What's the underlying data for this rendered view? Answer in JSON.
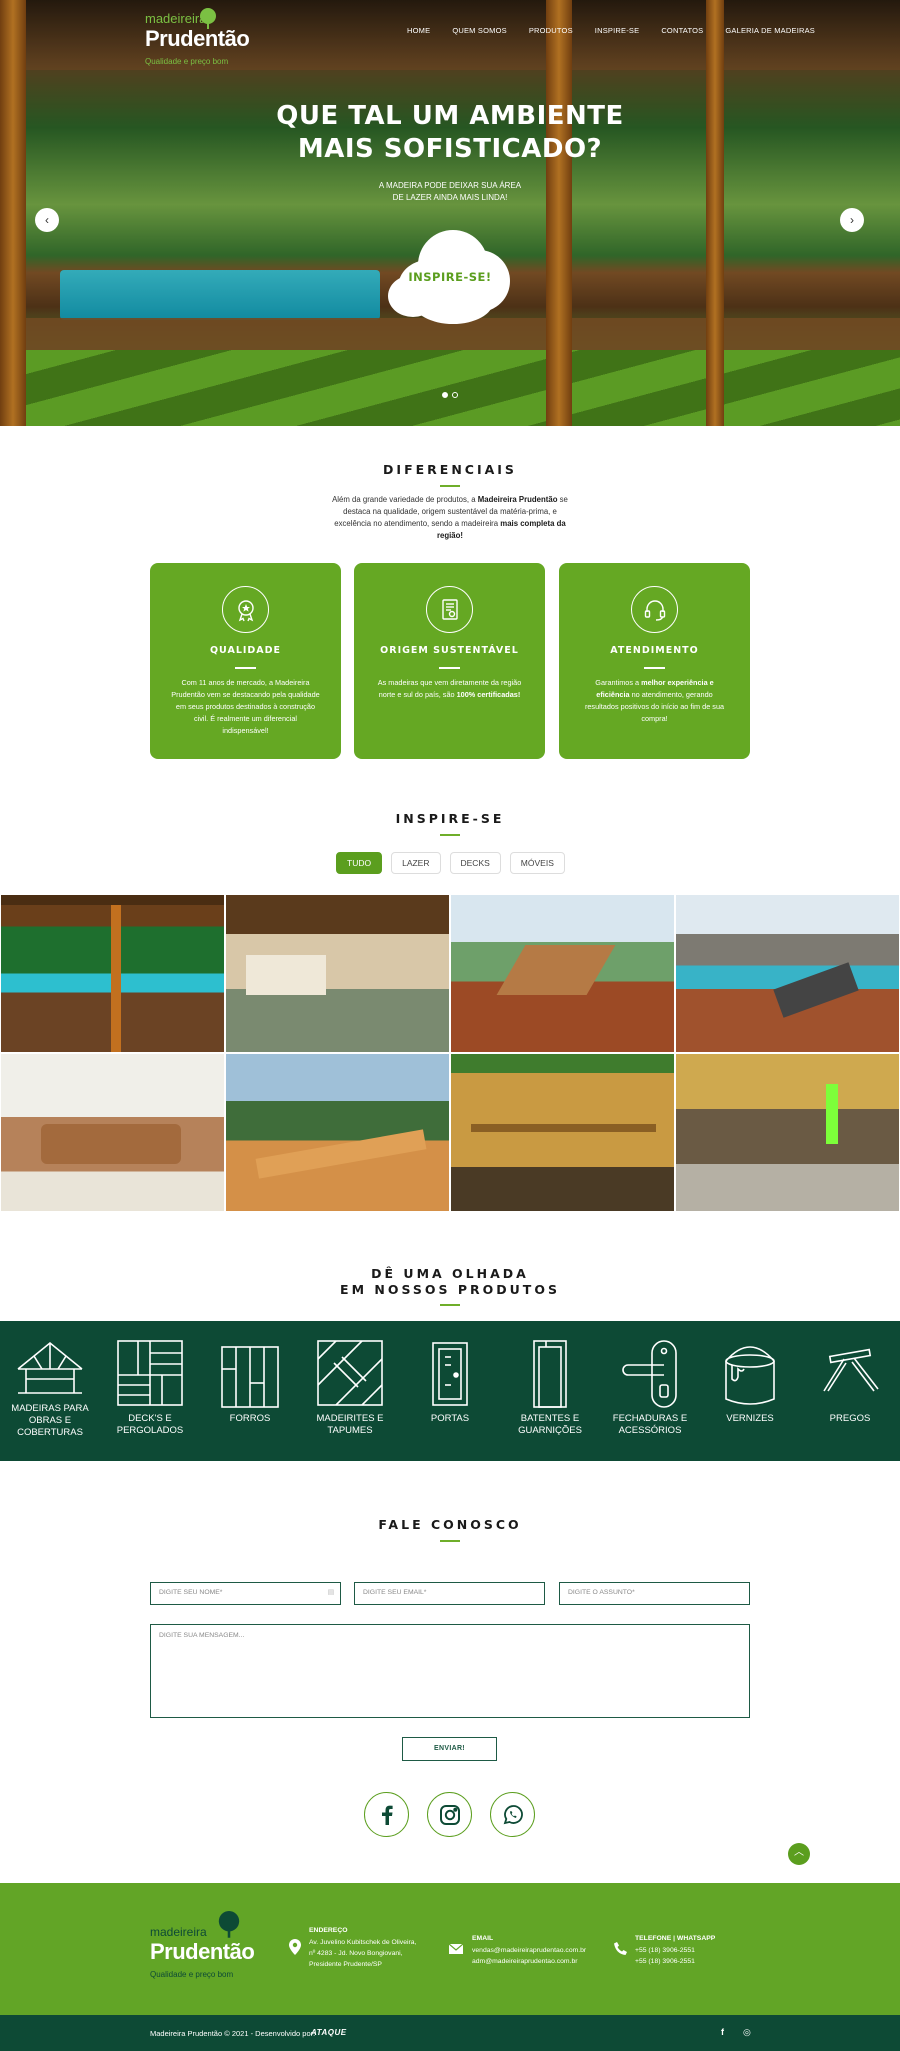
{
  "brand": {
    "logo_top": "madeireira",
    "logo_main": "Prudentão",
    "logo_tagline": "Qualidade e preço bom"
  },
  "nav": [
    "HOME",
    "QUEM SOMOS",
    "PRODUTOS",
    "INSPIRE-SE",
    "CONTATOS",
    "GALERIA DE MADEIRAS"
  ],
  "hero": {
    "title_line1": "QUE TAL UM AMBIENTE",
    "title_line2": "MAIS SOFISTICADO?",
    "sub_line1": "A MADEIRA PODE DEIXAR SUA ÁREA",
    "sub_line2": "DE LAZER AINDA MAIS LINDA!",
    "cta": "INSPIRE-SE!",
    "prev": "‹",
    "next": "›",
    "slides": 2,
    "active_slide": 1
  },
  "diferenciais": {
    "title": "DIFERENCIAIS",
    "intro_1": "Além da grande variedade de produtos, a",
    "intro_brand": "Madeireira Prudentão",
    "intro_2": "se destaca na qualidade, origem sustentável da matéria-prima, e excelência no atendimento, sendo a madeireira",
    "intro_bold": "mais completa da região!",
    "cards": [
      {
        "icon": "award-icon",
        "title": "QUALIDADE",
        "text": "Com 11 anos de mercado, a Madeireira Prudentão vem se destacando pela qualidade em seus produtos destinados à construção civil. É realmente um diferencial indispensável!"
      },
      {
        "icon": "certificate-icon",
        "title": "ORIGEM SUSTENTÁVEL",
        "text_a": "As madeiras que vem diretamente da região norte e sul do país, são ",
        "text_b": "100% certificadas!"
      },
      {
        "icon": "headset-icon",
        "title": "ATENDIMENTO",
        "text_a": "Garantimos a ",
        "text_b": "melhor experiência e eficiência",
        "text_c": " no atendimento, gerando resultados positivos do início ao fim de sua compra!"
      }
    ]
  },
  "inspire": {
    "title": "INSPIRE-SE",
    "tabs": [
      "TUDO",
      "LAZER",
      "DECKS",
      "MÓVEIS"
    ],
    "active_tab": "TUDO"
  },
  "products": {
    "title_line1": "DÊ UMA OLHADA",
    "title_line2": "EM NOSSOS PRODUTOS",
    "items": [
      {
        "label": "MADEIRAS PARA OBRAS E COBERTURAS",
        "icon": "roof-truss-icon"
      },
      {
        "label": "DECK'S E PERGOLADOS",
        "icon": "deck-icon"
      },
      {
        "label": "FORROS",
        "icon": "ceiling-panel-icon"
      },
      {
        "label": "MADEIRITES E TAPUMES",
        "icon": "plywood-icon"
      },
      {
        "label": "PORTAS",
        "icon": "door-icon"
      },
      {
        "label": "BATENTES E GUARNIÇÕES",
        "icon": "door-frame-icon"
      },
      {
        "label": "FECHADURAS E ACESSÓRIOS",
        "icon": "door-handle-icon"
      },
      {
        "label": "VERNIZES",
        "icon": "varnish-can-icon"
      },
      {
        "label": "PREGOS",
        "icon": "nails-icon"
      }
    ]
  },
  "contact": {
    "title": "FALE CONOSCO",
    "name_placeholder": "DIGITE SEU NOME*",
    "email_placeholder": "DIGITE SEU EMAIL*",
    "subject_placeholder": "DIGITE O ASSUNTO*",
    "message_placeholder": "DIGITE SUA MENSAGEM...",
    "send": "ENVIAR!"
  },
  "footer": {
    "address_title": "ENDEREÇO",
    "address_1": "Av. Juvelino Kubitschek de Oliveira,",
    "address_2": "nº 4283 - Jd. Novo Bongiovani,",
    "address_3": "Presidente Prudente/SP",
    "email_title": "EMAIL",
    "email_1": "vendas@madeireiraprudentao.com.br",
    "email_2": "adm@madeireiraprudentao.com.br",
    "phone_title": "TELEFONE | WHATSAPP",
    "phone_1": "+55 (18) 3906-2551",
    "phone_2": "+55 (18) 3906-2551",
    "copyright": "Madeireira Prudentão © 2021 - Desenvolvido por:",
    "agency": "ATAQUE"
  },
  "colors": {
    "brand_green": "#65a823",
    "dark_green": "#0d4a35",
    "white": "#ffffff"
  }
}
